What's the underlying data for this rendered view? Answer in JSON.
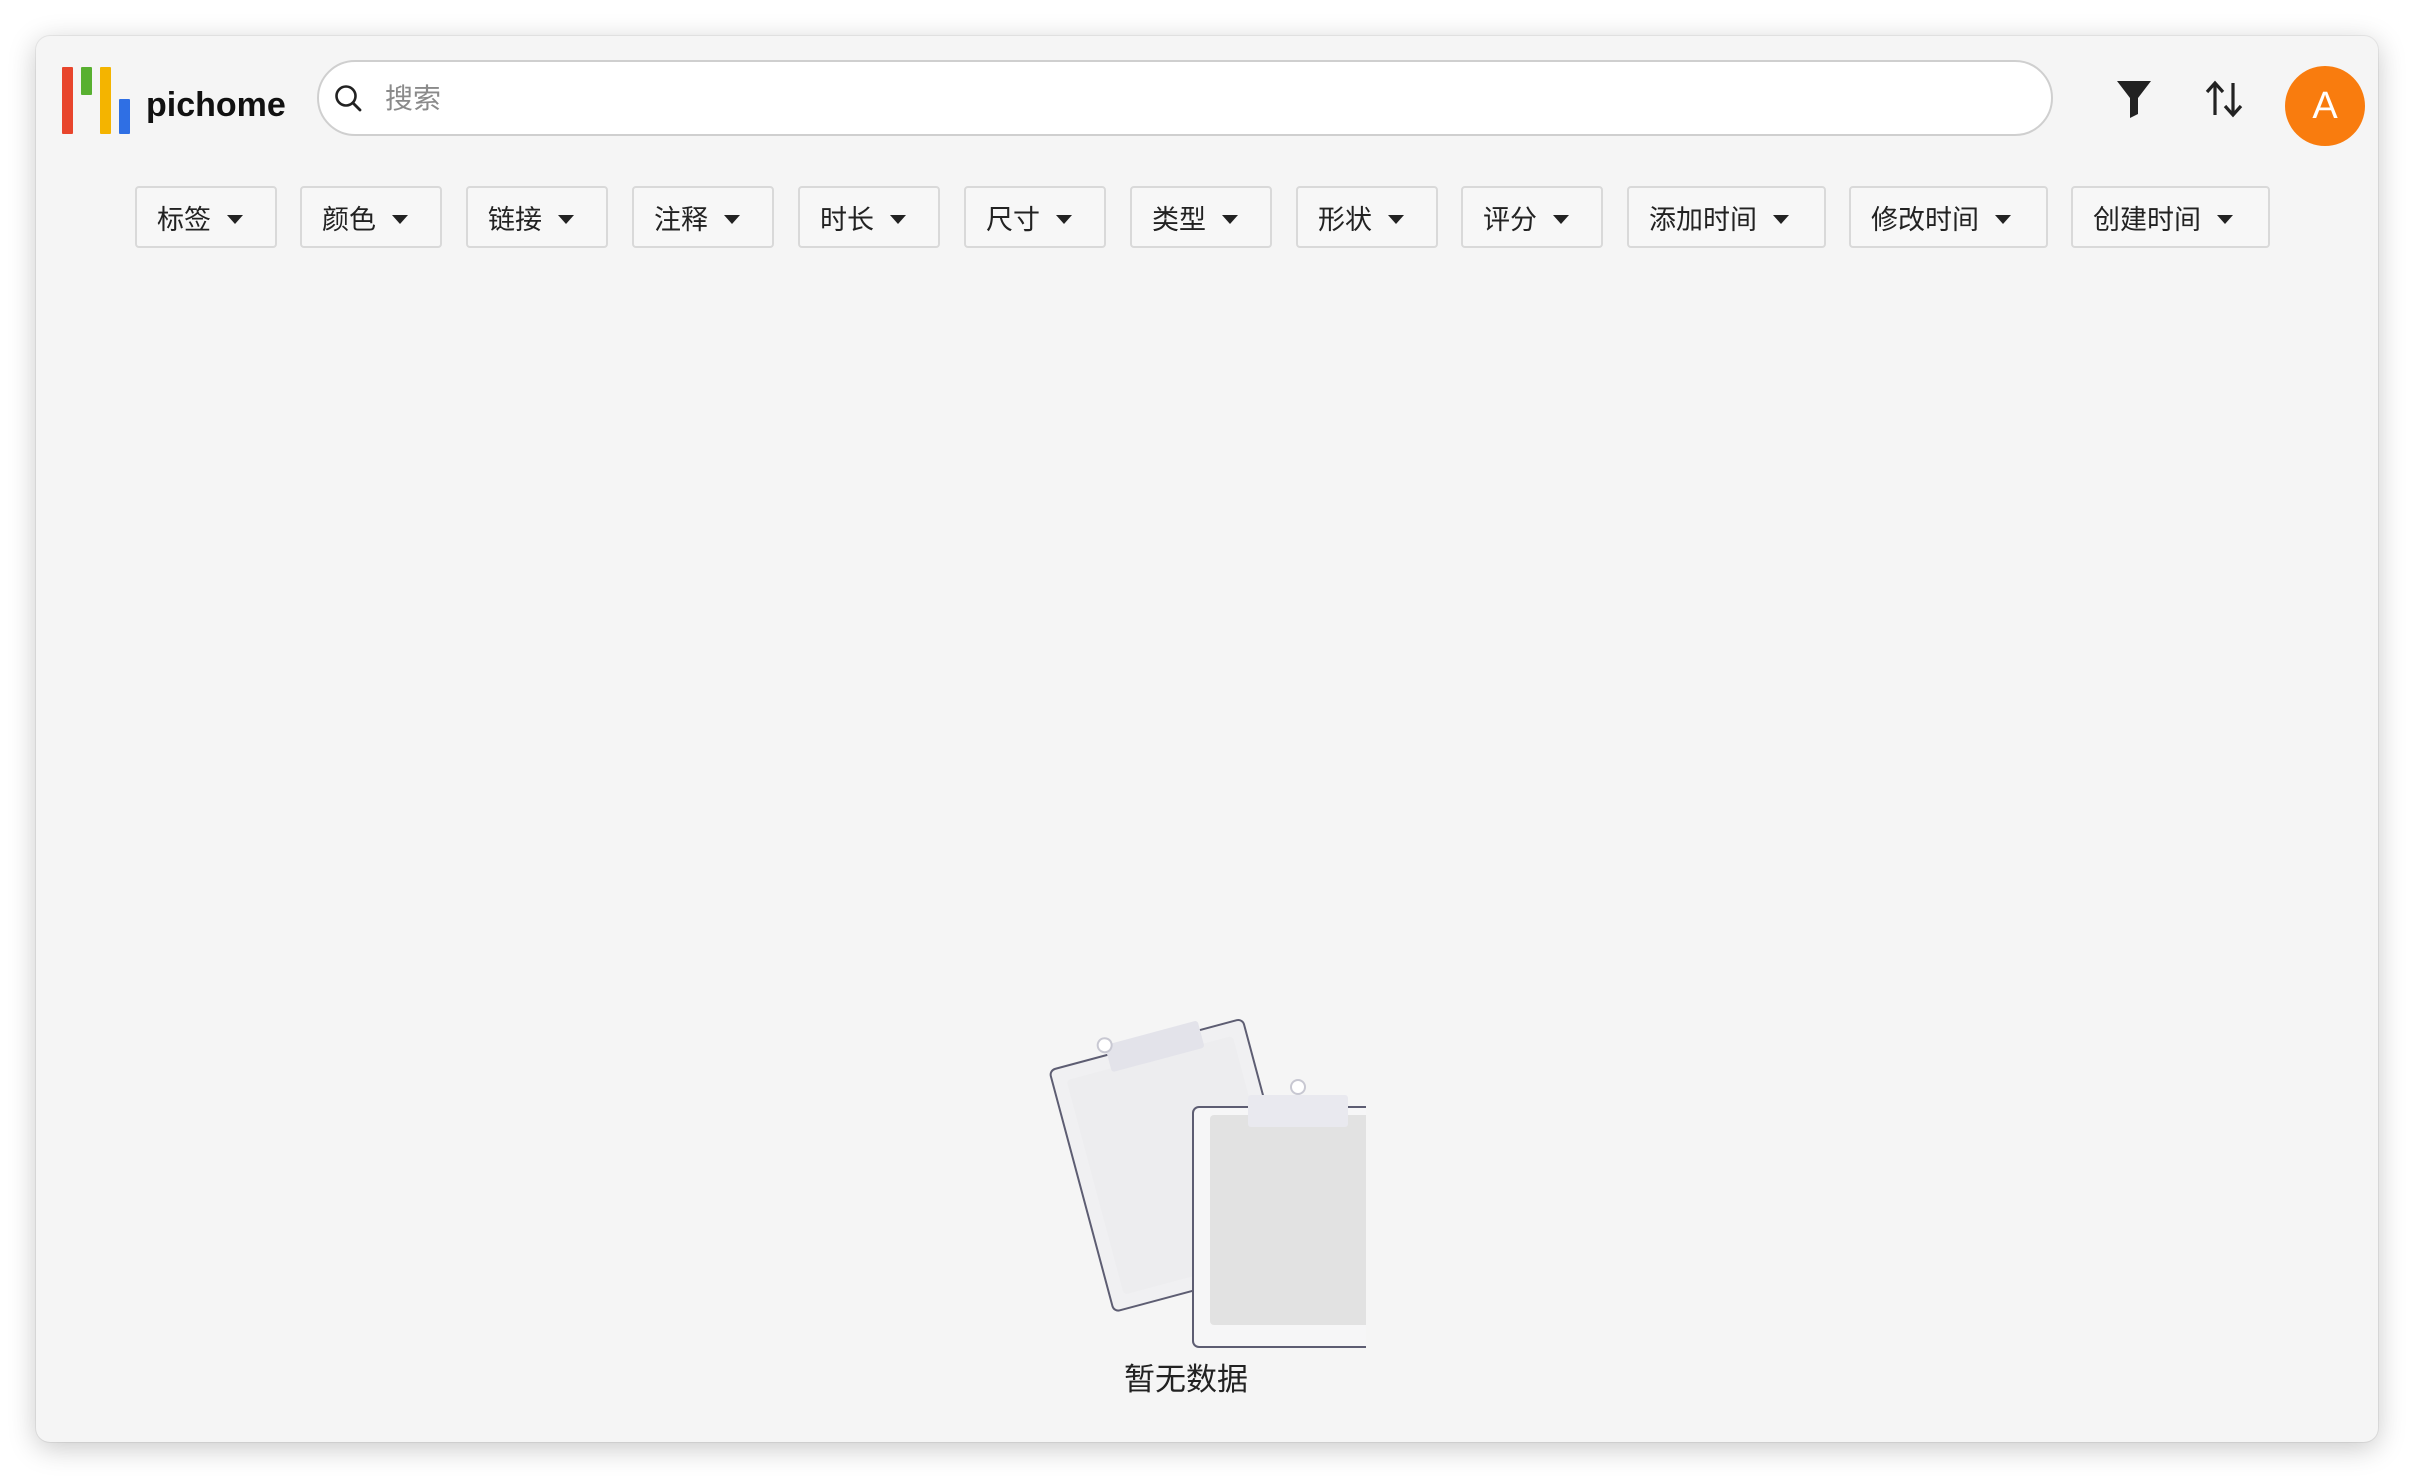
{
  "app": {
    "name": "pichome",
    "logo_colors": [
      "#e8452c",
      "#58b030",
      "#f4b400",
      "#2f6fe4"
    ]
  },
  "search": {
    "placeholder": "搜索",
    "value": ""
  },
  "header_icons": {
    "filter": "filter-icon",
    "sort": "sort-icon"
  },
  "avatar": {
    "initial": "A",
    "color": "#f97c0e"
  },
  "filters": [
    {
      "label": "标签"
    },
    {
      "label": "颜色"
    },
    {
      "label": "链接"
    },
    {
      "label": "注释"
    },
    {
      "label": "时长"
    },
    {
      "label": "尺寸"
    },
    {
      "label": "类型"
    },
    {
      "label": "形状"
    },
    {
      "label": "评分"
    },
    {
      "label": "添加时间"
    },
    {
      "label": "修改时间"
    },
    {
      "label": "创建时间"
    }
  ],
  "empty_state": {
    "icon": "empty-clipboard-icon",
    "text": "暂无数据"
  }
}
